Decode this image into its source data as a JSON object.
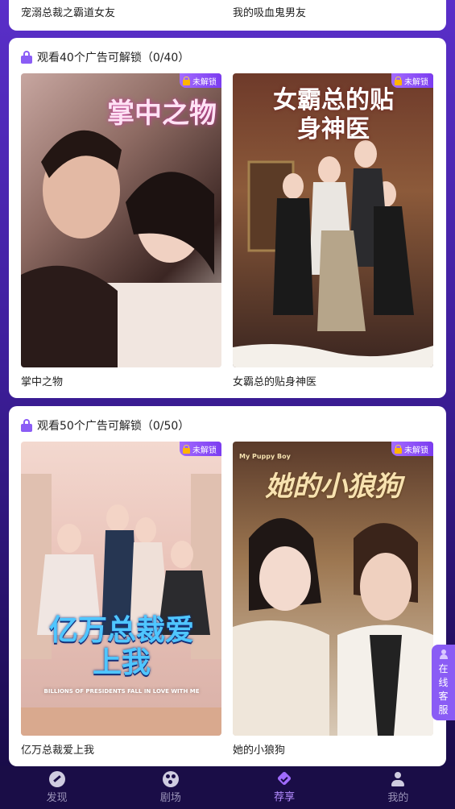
{
  "top_cards": {
    "left_title": "宠溺总裁之霸道女友",
    "right_title": "我的吸血鬼男友"
  },
  "sections": [
    {
      "title": "观看40个广告可解锁（0/40）",
      "items": [
        {
          "title": "掌中之物",
          "art_text": "掌中之物",
          "badge": "未解锁"
        },
        {
          "title": "女霸总的贴身神医",
          "art_text": "女霸总的贴身神医",
          "badge": "未解锁"
        }
      ]
    },
    {
      "title": "观看50个广告可解锁（0/50）",
      "items": [
        {
          "title": "亿万总裁爱上我",
          "art_text": "亿万总裁爱上我",
          "art_subtext": "BILLIONS OF PRESIDENTS FALL IN LOVE WITH ME",
          "badge": "未解锁"
        },
        {
          "title": "她的小狼狗",
          "art_text": "她的小狼狗",
          "art_subtext": "My Puppy Boy",
          "badge": "未解锁"
        }
      ]
    }
  ],
  "service_button": [
    "在",
    "线",
    "客",
    "服"
  ],
  "nav": [
    {
      "label": "发现",
      "icon": "discover-icon",
      "active": false
    },
    {
      "label": "剧场",
      "icon": "theater-icon",
      "active": false
    },
    {
      "label": "荐享",
      "icon": "recommend-icon",
      "active": true
    },
    {
      "label": "我的",
      "icon": "profile-icon",
      "active": false
    }
  ],
  "colors": {
    "accent": "#8a5cf5",
    "background_top": "#5a2fc9",
    "background_bottom": "#150a3f"
  }
}
